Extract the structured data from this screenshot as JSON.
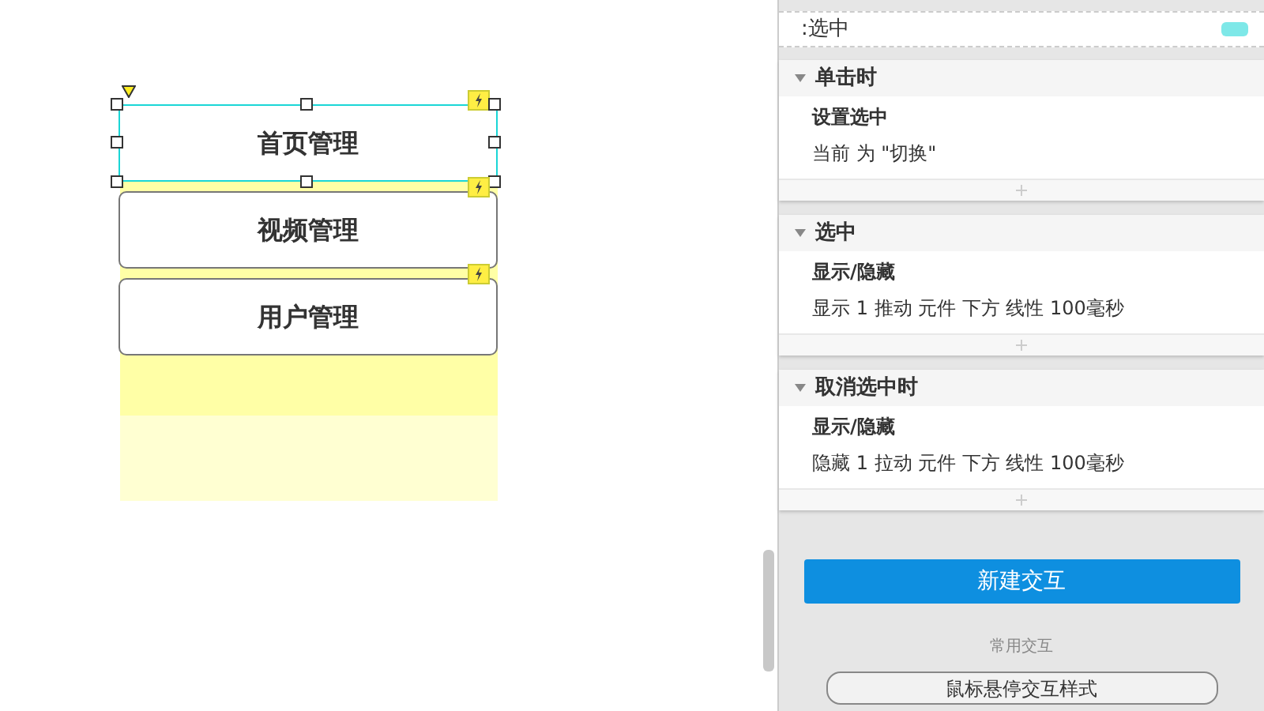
{
  "canvas": {
    "widgets": [
      {
        "label": "首页管理",
        "selected": true
      },
      {
        "label": "视频管理",
        "selected": false
      },
      {
        "label": "用户管理",
        "selected": false
      }
    ]
  },
  "panel": {
    "state_row": {
      "label": ":选中",
      "color": "#7ee8e8"
    },
    "events": [
      {
        "name": "单击时",
        "expanded": true,
        "actions": [
          {
            "title": "设置选中",
            "detail": "当前 为 \"切换\""
          }
        ]
      },
      {
        "name": "选中",
        "expanded": true,
        "actions": [
          {
            "title": "显示/隐藏",
            "detail": "显示 1  推动 元件 下方 线性 100毫秒"
          }
        ]
      },
      {
        "name": "取消选中时",
        "expanded": true,
        "actions": [
          {
            "title": "显示/隐藏",
            "detail": "隐藏 1  拉动 元件 下方 线性 100毫秒"
          }
        ]
      }
    ],
    "new_button": "新建交互",
    "common_label": "常用交互",
    "hover_button": "鼠标悬停交互样式"
  }
}
